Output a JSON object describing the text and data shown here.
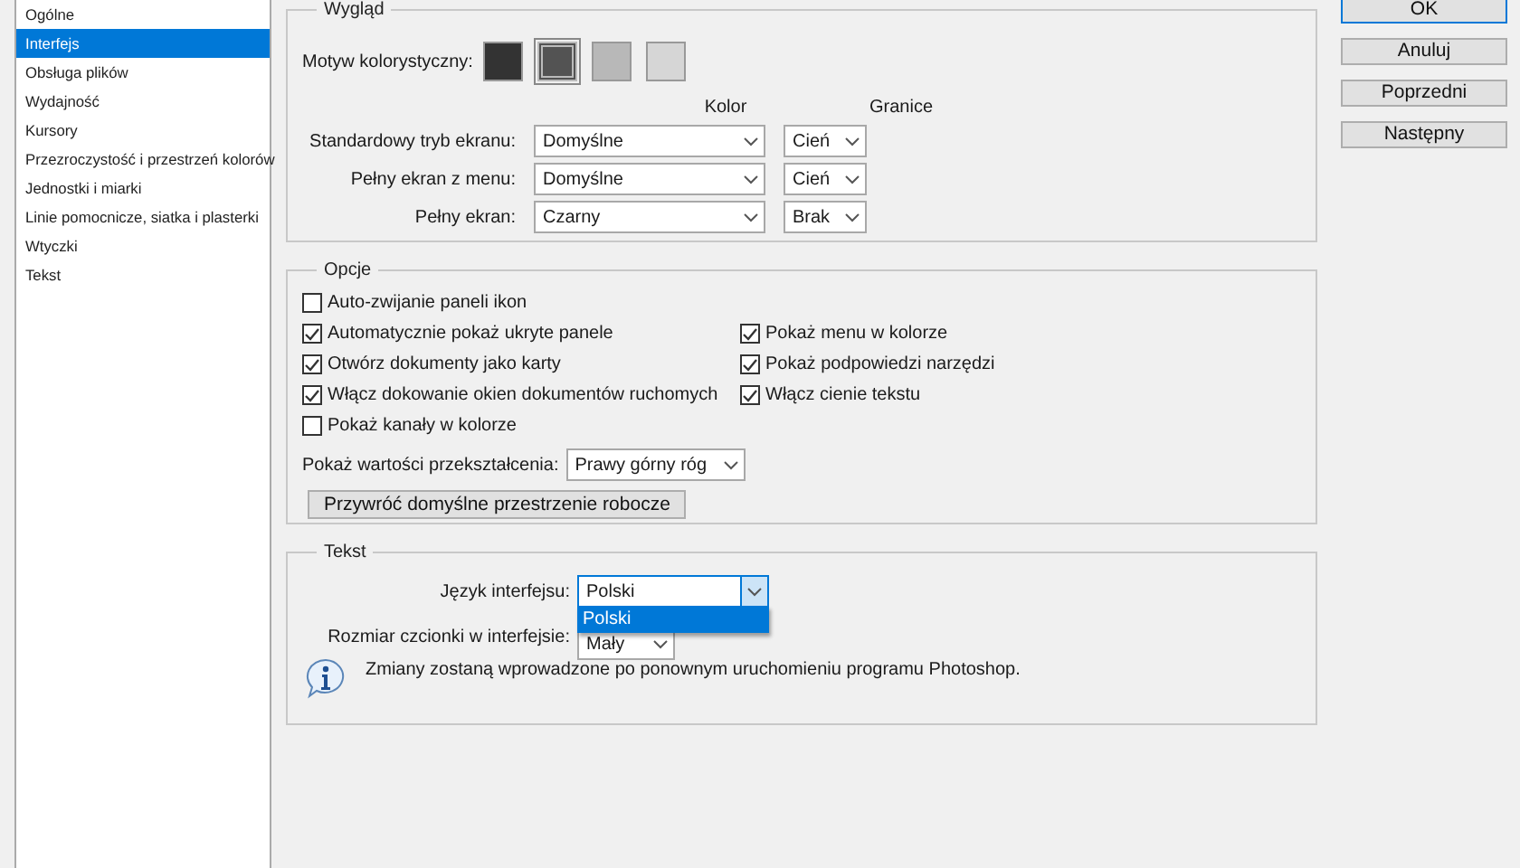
{
  "sidebar": {
    "items": [
      {
        "label": "Ogólne",
        "selected": false
      },
      {
        "label": "Interfejs",
        "selected": true
      },
      {
        "label": "Obsługa plików",
        "selected": false
      },
      {
        "label": "Wydajność",
        "selected": false
      },
      {
        "label": "Kursory",
        "selected": false
      },
      {
        "label": "Przezroczystość i przestrzeń kolorów",
        "selected": false
      },
      {
        "label": "Jednostki i miarki",
        "selected": false
      },
      {
        "label": "Linie pomocnicze, siatka i plasterki",
        "selected": false
      },
      {
        "label": "Wtyczki",
        "selected": false
      },
      {
        "label": "Tekst",
        "selected": false
      }
    ]
  },
  "appearance": {
    "legend": "Wygląd",
    "theme_label": "Motyw kolorystyczny:",
    "themes": [
      {
        "color": "#333333",
        "selected": false
      },
      {
        "color": "#535353",
        "selected": true
      },
      {
        "color": "#b8b8b8",
        "selected": false
      },
      {
        "color": "#d6d6d6",
        "selected": false
      }
    ],
    "column_headers": [
      "Kolor",
      "Granice"
    ],
    "rows": [
      {
        "label": "Standardowy tryb ekranu:",
        "color_mode": "Domyślne",
        "border": "Cień"
      },
      {
        "label": "Pełny ekran z menu:",
        "color_mode": "Domyślne",
        "border": "Cień"
      },
      {
        "label": "Pełny ekran:",
        "color_mode": "Czarny",
        "border": "Brak"
      }
    ]
  },
  "options": {
    "legend": "Opcje",
    "left": [
      {
        "label": "Auto-zwijanie paneli ikon",
        "checked": false
      },
      {
        "label": "Automatycznie pokaż ukryte panele",
        "checked": true
      },
      {
        "label": "Otwórz dokumenty jako karty",
        "checked": true
      },
      {
        "label": "Włącz dokowanie okien dokumentów ruchomych",
        "checked": true
      },
      {
        "label": "Pokaż kanały w kolorze",
        "checked": false
      }
    ],
    "right": [
      {
        "label": "Pokaż menu w kolorze",
        "checked": true
      },
      {
        "label": "Pokaż podpowiedzi narzędzi",
        "checked": true
      },
      {
        "label": "Włącz cienie tekstu",
        "checked": true
      }
    ],
    "transform_label": "Pokaż wartości przekształcenia:",
    "transform_value": "Prawy górny róg",
    "reset_button": "Przywróć domyślne przestrzenie robocze"
  },
  "text": {
    "legend": "Tekst",
    "language_label": "Język interfejsu:",
    "language_value": "Polski",
    "language_open": true,
    "language_options": [
      {
        "label": "Polski",
        "selected": true
      }
    ],
    "size_label": "Rozmiar czcionki w interfejsie:",
    "size_value": "Mały",
    "info": "Zmiany zostaną wprowadzone po ponownym uruchomieniu programu Photoshop."
  },
  "buttons": [
    {
      "label": "OK",
      "default": true
    },
    {
      "label": "Anuluj",
      "default": false
    },
    {
      "label": "Poprzedni",
      "default": false
    },
    {
      "label": "Następny",
      "default": false
    }
  ]
}
